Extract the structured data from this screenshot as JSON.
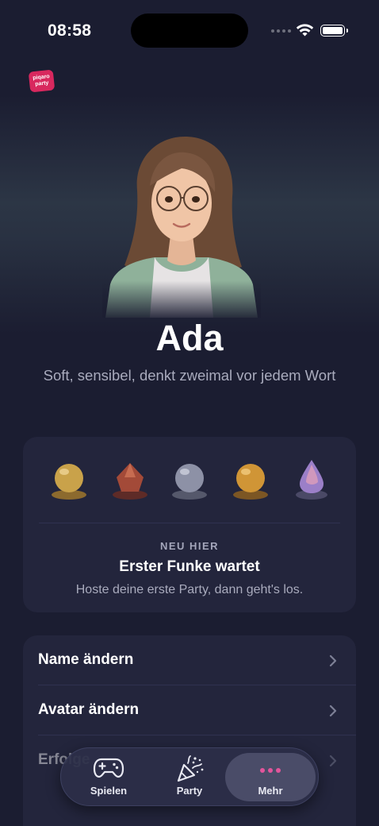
{
  "status_bar": {
    "time": "08:58"
  },
  "app": {
    "logo_line1": "piqaro",
    "logo_line2": "party"
  },
  "profile": {
    "name": "Ada",
    "bio": "Soft, sensibel, denkt zweimal vor jedem Wort"
  },
  "level_card": {
    "kicker": "NEU HIER",
    "title": "Erster Funke wartet",
    "subtitle": "Hoste deine erste Party, dann geht's los.",
    "gems": [
      {
        "icon": "gold-orb-icon",
        "color": "#c9a24a"
      },
      {
        "icon": "ruby-crystal-icon",
        "color": "#a34a38"
      },
      {
        "icon": "silver-orb-icon",
        "color": "#8d91a6"
      },
      {
        "icon": "amber-orb-icon",
        "color": "#d09536"
      },
      {
        "icon": "opal-drop-icon",
        "color": "#9b7fc8"
      }
    ]
  },
  "settings": [
    {
      "label": "Name ändern"
    },
    {
      "label": "Avatar ändern"
    },
    {
      "label": "Erfolge"
    }
  ],
  "tab_bar": {
    "tabs": [
      {
        "label": "Spielen",
        "icon": "gamepad-icon"
      },
      {
        "label": "Party",
        "icon": "party-popper-icon"
      },
      {
        "label": "Mehr",
        "icon": "more-dots-icon"
      }
    ],
    "active": "Mehr",
    "accent": "#e2559b"
  }
}
